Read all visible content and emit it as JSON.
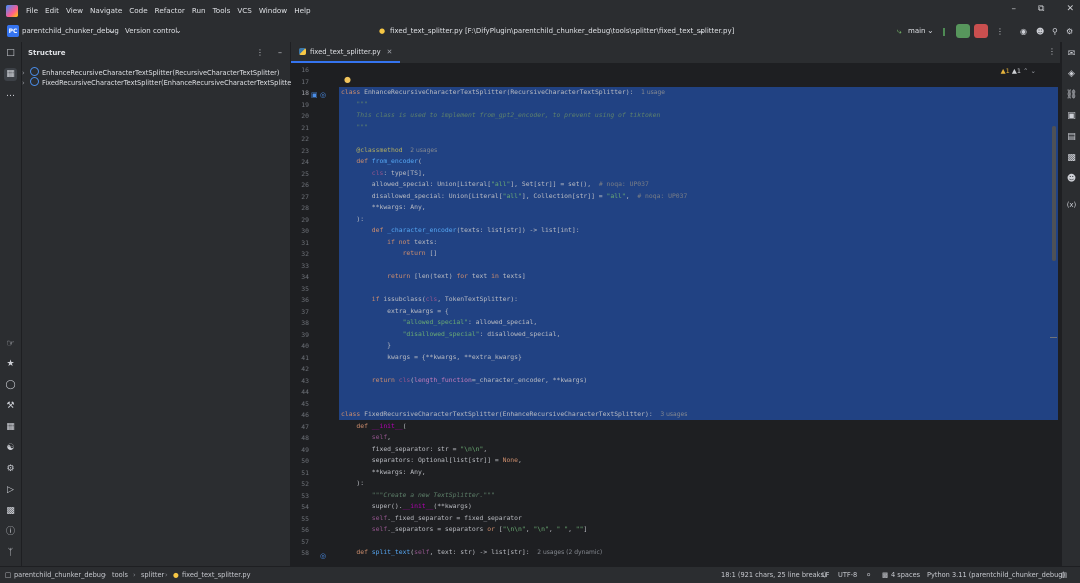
{
  "menu": [
    "File",
    "Edit",
    "View",
    "Navigate",
    "Code",
    "Refactor",
    "Run",
    "Tools",
    "VCS",
    "Window",
    "Help"
  ],
  "toolbar": {
    "project_badge": "PC",
    "project_name": "parentchild_chunker_debug",
    "vcs": "Version control",
    "file_title": "fixed_text_splitter.py [F:\\DifyPlugin\\parentchild_chunker_debug\\tools\\splitter\\fixed_text_splitter.py]",
    "branch": "main"
  },
  "structure": {
    "title": "Structure",
    "items": [
      "EnhanceRecursiveCharacterTextSplitter(RecursiveCharacterTextSplitter)",
      "FixedRecursiveCharacterTextSplitter(EnhanceRecursiveCharacterTextSplitter)"
    ]
  },
  "editor": {
    "tab_label": "fixed_text_splitter.py",
    "inspections": {
      "warnings": "1",
      "weak_warnings": "1"
    },
    "line_numbers": [
      "16",
      "17",
      "18",
      "19",
      "20",
      "21",
      "22",
      "23",
      "24",
      "25",
      "26",
      "27",
      "28",
      "29",
      "30",
      "31",
      "32",
      "33",
      "34",
      "35",
      "36",
      "37",
      "38",
      "39",
      "40",
      "41",
      "42",
      "43",
      "44",
      "45",
      "46",
      "47",
      "48",
      "49",
      "50",
      "51",
      "52",
      "53",
      "54",
      "55",
      "56",
      "57",
      "58"
    ],
    "hints": {
      "l18": "1 usage",
      "l23": "2 usages",
      "l46": "3 usages",
      "l58": "2 usages (2 dynamic)"
    }
  },
  "status": {
    "breadcrumb": [
      "parentchild_chunker_debug",
      "tools",
      "splitter",
      "fixed_text_splitter.py"
    ],
    "position": "18:1 (921 chars, 25 line breaks)",
    "line_sep": "LF",
    "encoding": "UTF-8",
    "indent": "4 spaces",
    "interpreter": "Python 3.11 (parentchild_chunker_debug)"
  }
}
